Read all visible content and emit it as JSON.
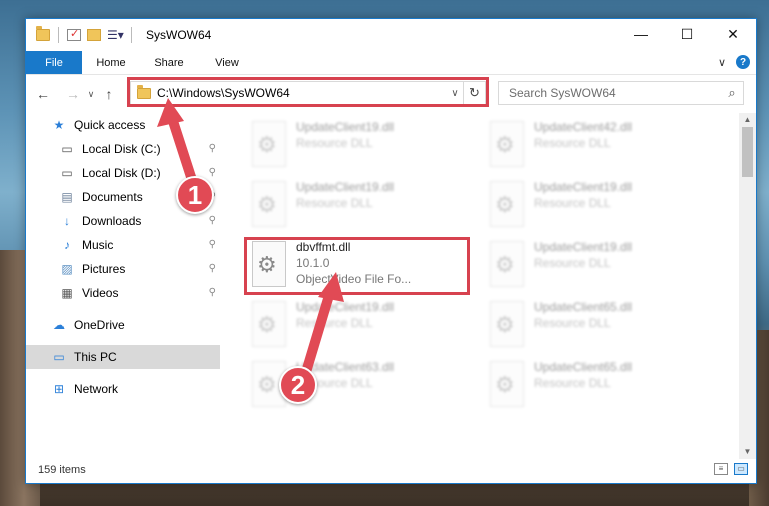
{
  "window": {
    "title": "SysWOW64",
    "caption": {
      "minimize": "—",
      "maximize": "☐",
      "close": "✕"
    }
  },
  "ribbon": {
    "tabs": [
      {
        "label": "File",
        "active": true
      },
      {
        "label": "Home"
      },
      {
        "label": "Share"
      },
      {
        "label": "View"
      }
    ],
    "expand": "∨",
    "help": "?"
  },
  "nav": {
    "back": "←",
    "forward": "→",
    "recent": "∨",
    "up": "↑",
    "address": "C:\\Windows\\SysWOW64",
    "address_drop": "∨",
    "refresh": "↻",
    "search_placeholder": "Search SysWOW64",
    "search_icon": "⌕"
  },
  "sidebar": {
    "items": [
      {
        "label": "Quick access",
        "icon": "★",
        "icon_name": "star-icon",
        "color": "#2b7fd8",
        "pinned": false,
        "sub": false
      },
      {
        "label": "Local Disk (C:)",
        "icon": "▭",
        "icon_name": "drive-icon",
        "color": "#555",
        "pinned": true,
        "sub": true
      },
      {
        "label": "Local Disk (D:)",
        "icon": "▭",
        "icon_name": "drive-icon",
        "color": "#555",
        "pinned": true,
        "sub": true
      },
      {
        "label": "Documents",
        "icon": "▤",
        "icon_name": "documents-icon",
        "color": "#6b7f99",
        "pinned": true,
        "sub": true
      },
      {
        "label": "Downloads",
        "icon": "↓",
        "icon_name": "downloads-icon",
        "color": "#2b7fd8",
        "pinned": true,
        "sub": true
      },
      {
        "label": "Music",
        "icon": "♪",
        "icon_name": "music-icon",
        "color": "#2b7fd8",
        "pinned": true,
        "sub": true
      },
      {
        "label": "Pictures",
        "icon": "▨",
        "icon_name": "pictures-icon",
        "color": "#5a8fc2",
        "pinned": true,
        "sub": true
      },
      {
        "label": "Videos",
        "icon": "▦",
        "icon_name": "videos-icon",
        "color": "#555",
        "pinned": true,
        "sub": true
      }
    ],
    "onedrive": {
      "label": "OneDrive",
      "icon": "☁",
      "color": "#2b7fd8"
    },
    "thispc": {
      "label": "This PC",
      "icon": "▭",
      "color": "#2b7fd8"
    },
    "network": {
      "label": "Network",
      "icon": "⊞",
      "color": "#2b7fd8"
    },
    "pin_glyph": "⚲"
  },
  "files": {
    "left": [
      {
        "name": "UpdateClient19.dll",
        "sub": "Resource DLL",
        "blur": true
      },
      {
        "name": "UpdateClient19.dll",
        "sub": "Resource DLL",
        "blur": true
      },
      {
        "name": "dbvffmt.dll",
        "sub": "10.1.0",
        "sub2": "ObjectVideo File Fo...",
        "blur": false
      },
      {
        "name": "UpdateClient19.dll",
        "sub": "Resource DLL",
        "blur": true
      },
      {
        "name": "UpdateClient63.dll",
        "sub": "Resource DLL",
        "blur": true
      }
    ],
    "right": [
      {
        "name": "UpdateClient42.dll",
        "sub": "Resource DLL",
        "blur": true
      },
      {
        "name": "UpdateClient19.dll",
        "sub": "Resource DLL",
        "blur": true
      },
      {
        "name": "UpdateClient19.dll",
        "sub": "Resource DLL",
        "blur": true
      },
      {
        "name": "UpdateClient65.dll",
        "sub": "Resource DLL",
        "blur": true
      },
      {
        "name": "UpdateClient65.dll",
        "sub": "Resource DLL",
        "blur": true
      }
    ]
  },
  "status": {
    "count": "159 items"
  },
  "callouts": {
    "one": "1",
    "two": "2",
    "color": "#e14a55"
  }
}
